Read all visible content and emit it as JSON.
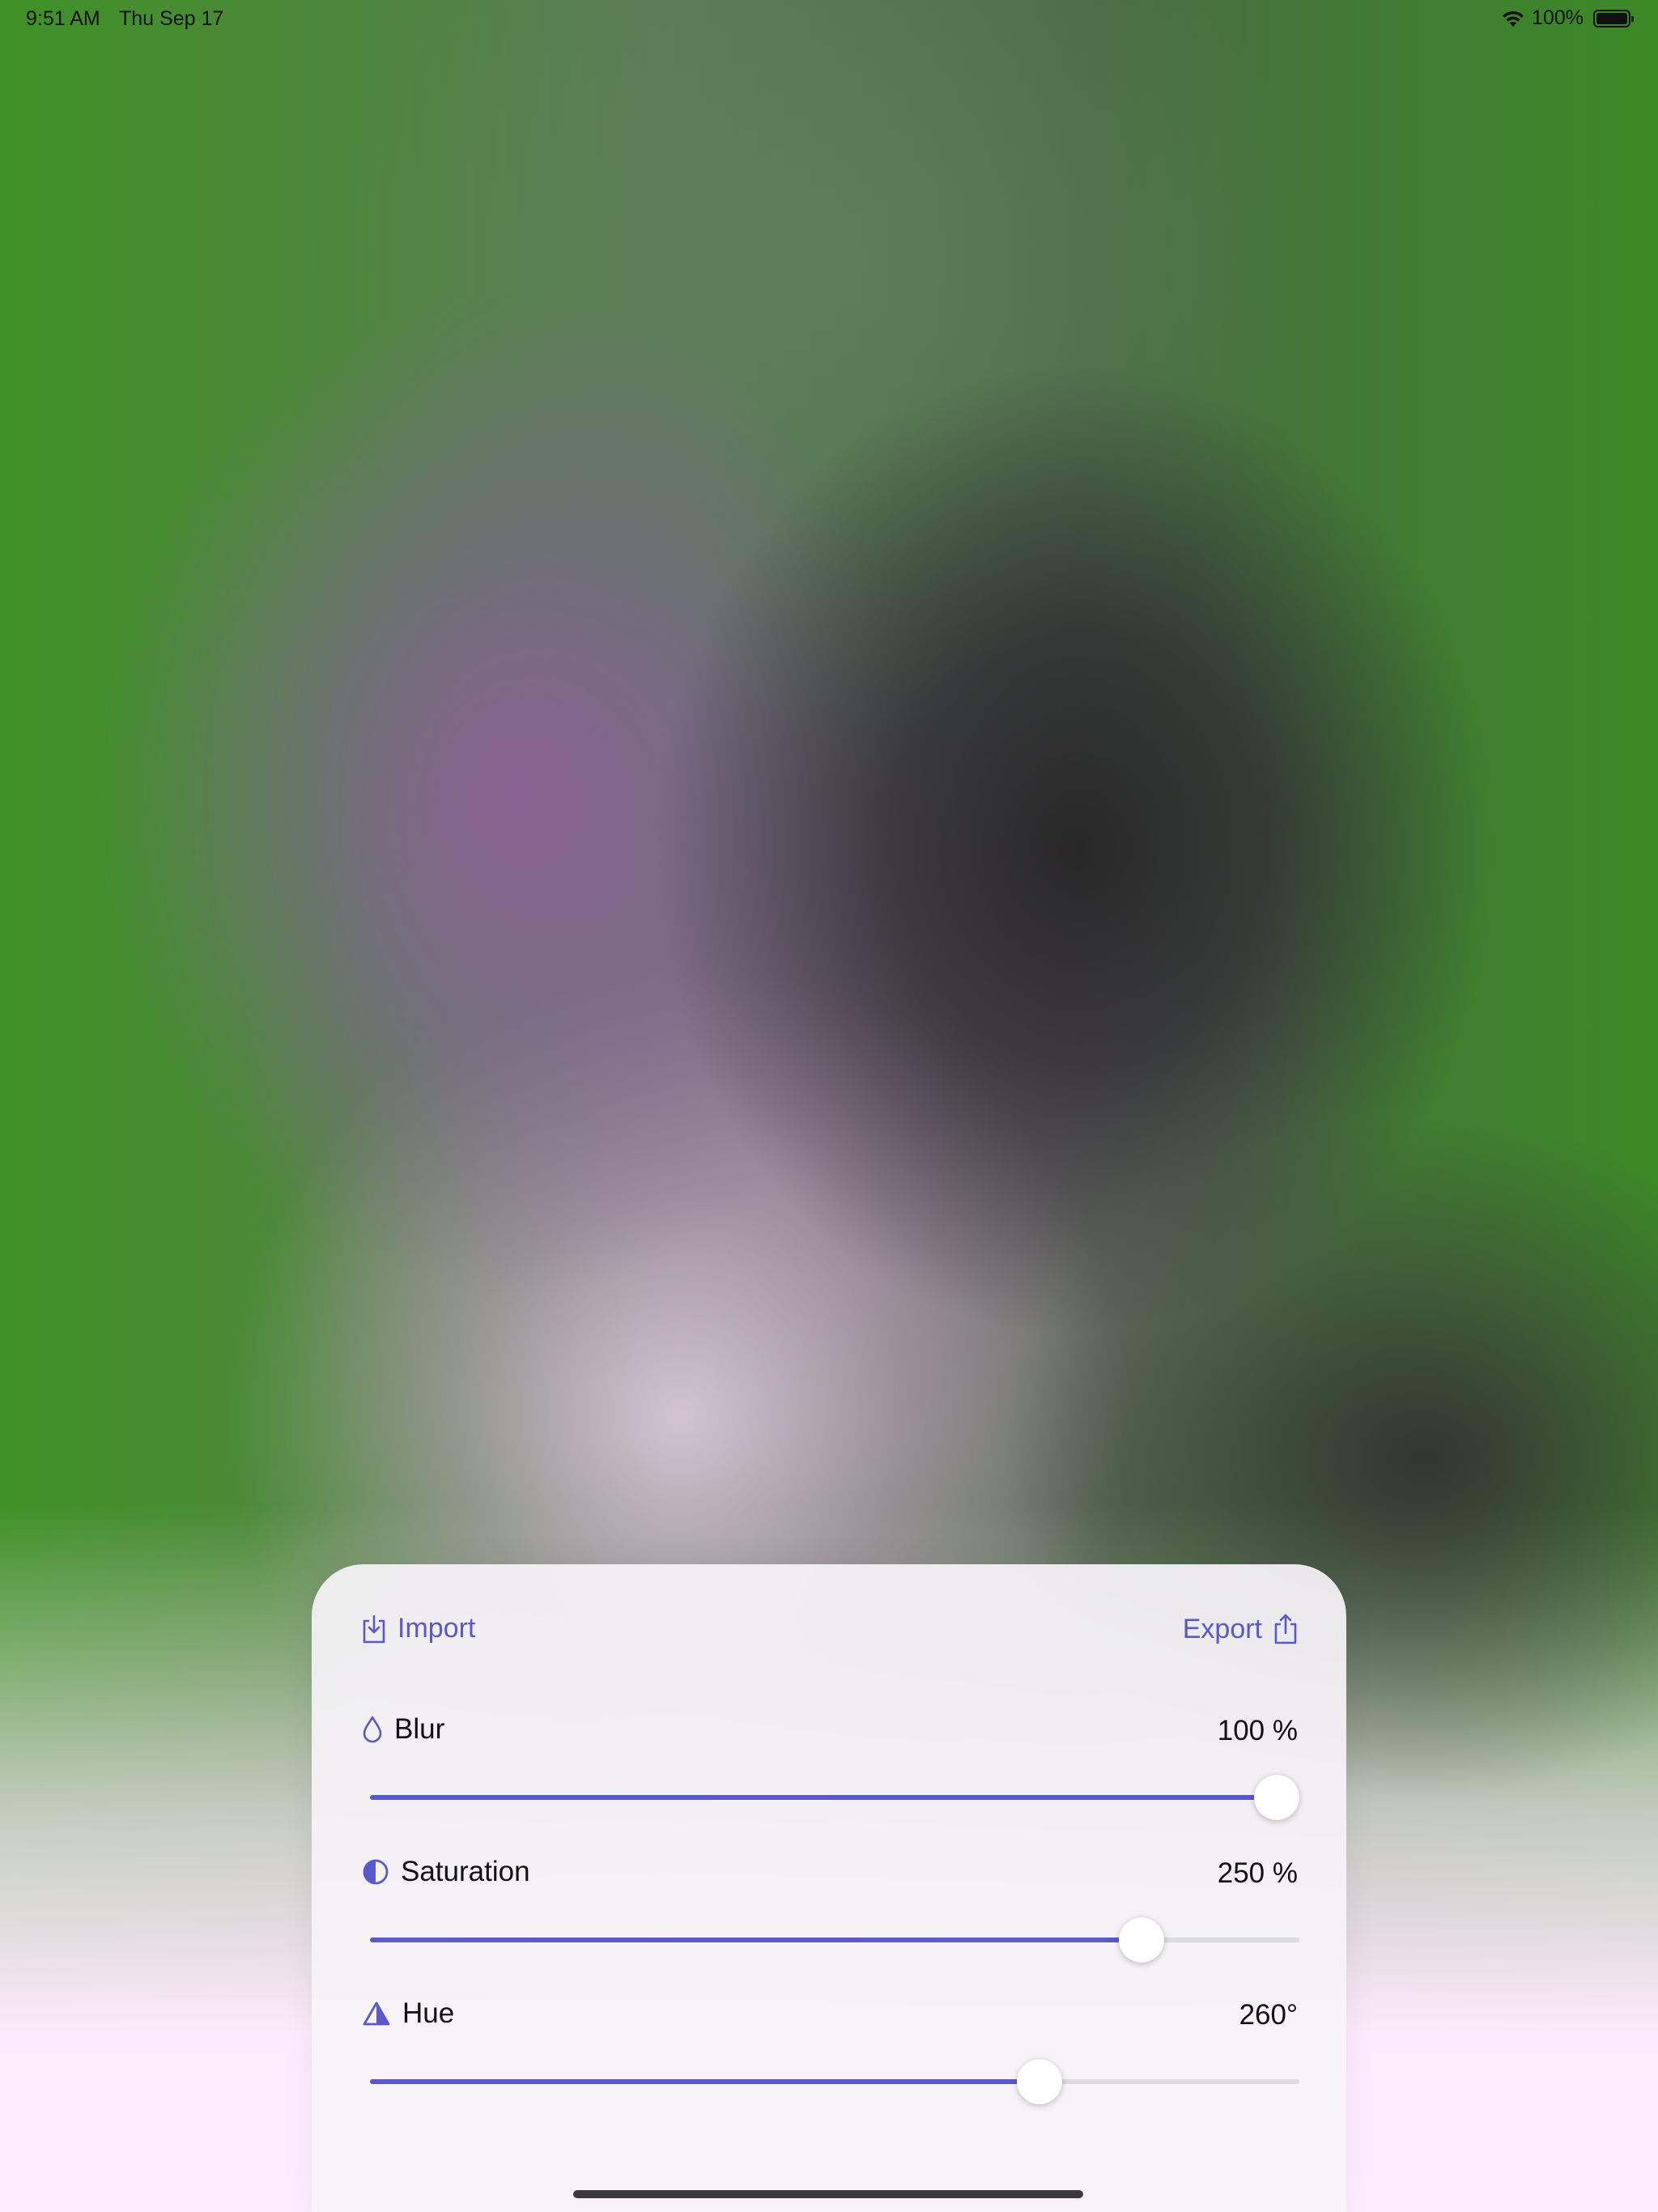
{
  "status_bar": {
    "time": "9:51 AM",
    "date": "Thu Sep 17",
    "battery_percent": "100%",
    "battery_level": 1.0
  },
  "panel": {
    "import_label": "Import",
    "import_icon": "import-icon",
    "export_label": "Export",
    "export_icon": "share-icon",
    "accent_color": "#5b57cf",
    "controls": [
      {
        "label": "Blur",
        "icon": "drop-icon",
        "value_text": "100 %",
        "fraction": 1.0
      },
      {
        "label": "Saturation",
        "icon": "half-circle-icon",
        "value_text": "250 %",
        "fraction": 0.83
      },
      {
        "label": "Hue",
        "icon": "triangle-icon",
        "value_text": "260°",
        "fraction": 0.72
      }
    ]
  }
}
